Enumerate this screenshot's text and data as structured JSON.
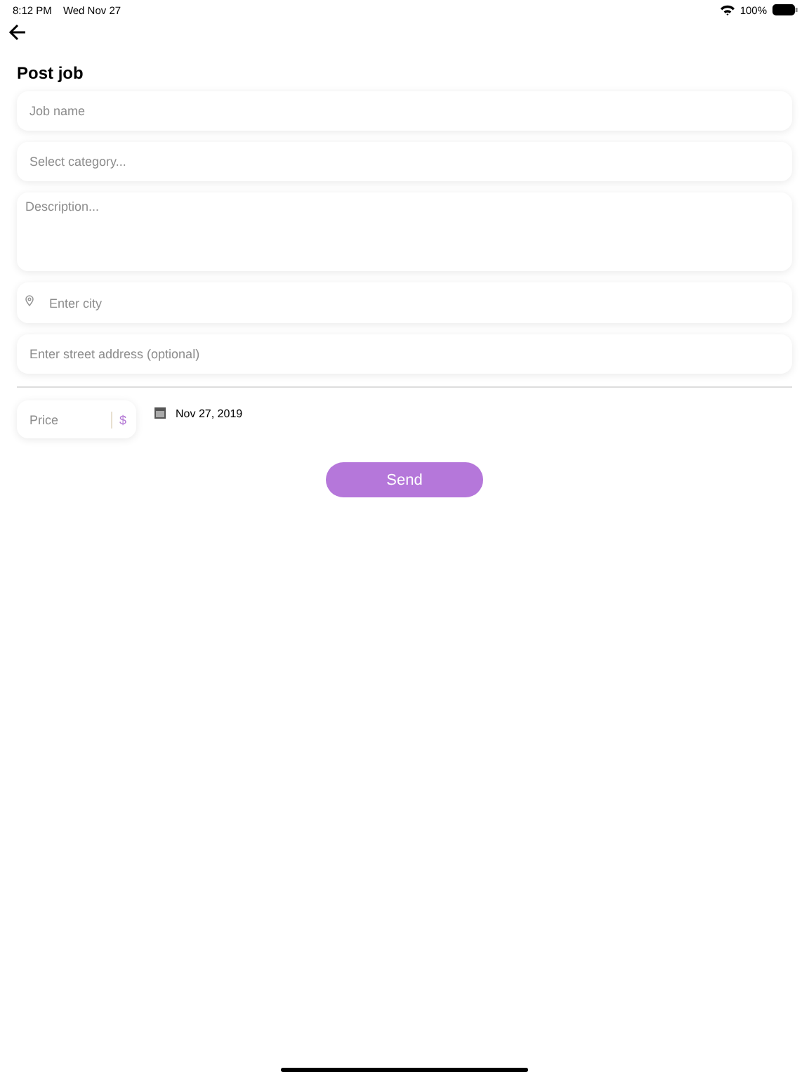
{
  "status_bar": {
    "time": "8:12 PM",
    "date": "Wed Nov 27",
    "battery": "100%"
  },
  "title": "Post job",
  "fields": [
    {
      "kind": "text",
      "placeholder": "Job name"
    },
    {
      "kind": "text",
      "placeholder": "Select category..."
    },
    {
      "kind": "textarea",
      "placeholder": "Description..."
    },
    {
      "kind": "location",
      "placeholder": "Enter city"
    },
    {
      "kind": "text",
      "placeholder": "Enter street address (optional)"
    }
  ],
  "price": {
    "placeholder": "Price",
    "currency": "$"
  },
  "date": "Nov 27, 2019",
  "send_button": "Send"
}
